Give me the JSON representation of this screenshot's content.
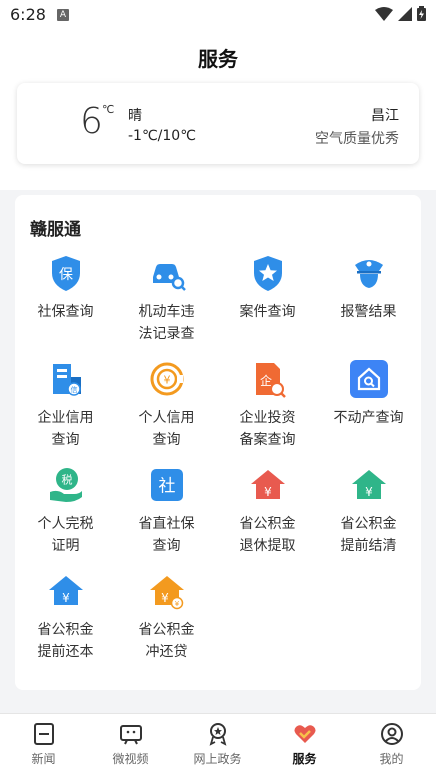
{
  "status": {
    "time": "6:28",
    "app_icon_letter": "A"
  },
  "header": {
    "title": "服务"
  },
  "weather": {
    "temp": "6",
    "unit": "℃",
    "condition": "晴",
    "range": "-1℃/10℃",
    "city": "昌江",
    "air_quality": "空气质量优秀"
  },
  "section": {
    "title": "赣服通",
    "items": [
      {
        "label": "社保查询",
        "icon": "shield-icon",
        "color": "#2f8ee8"
      },
      {
        "label": "机动车违\n法记录查",
        "icon": "car-search-icon",
        "color": "#2f8ee8"
      },
      {
        "label": "案件查询",
        "icon": "star-badge-icon",
        "color": "#2f8ee8"
      },
      {
        "label": "报警结果",
        "icon": "police-icon",
        "color": "#2f8ee8"
      },
      {
        "label": "企业信用\n查询",
        "icon": "enterprise-credit-icon",
        "color": "#2f8ee8"
      },
      {
        "label": "个人信用\n查询",
        "icon": "personal-credit-icon",
        "color": "#f39a1f"
      },
      {
        "label": "企业投资\n备案查询",
        "icon": "enterprise-invest-icon",
        "color": "#f06a33"
      },
      {
        "label": "不动产查询",
        "icon": "real-estate-icon",
        "color": "#3d84f5"
      },
      {
        "label": "个人完税\n证明",
        "icon": "tax-icon",
        "color": "#2fb589"
      },
      {
        "label": "省直社保\n查询",
        "icon": "social-security-icon",
        "color": "#2f8ee8"
      },
      {
        "label": "省公积金\n退休提取",
        "icon": "fund-house-red-icon",
        "color": "#e85a4f"
      },
      {
        "label": "省公积金\n提前结清",
        "icon": "fund-house-green-icon",
        "color": "#2fb589"
      },
      {
        "label": "省公积金\n提前还本",
        "icon": "fund-house-blue-icon",
        "color": "#2f8ee8"
      },
      {
        "label": "省公积金\n冲还贷",
        "icon": "fund-house-orange-icon",
        "color": "#f39a1f"
      }
    ]
  },
  "tabs": [
    {
      "label": "新闻",
      "icon": "news-icon",
      "active": false
    },
    {
      "label": "微视频",
      "icon": "video-icon",
      "active": false
    },
    {
      "label": "网上政务",
      "icon": "gov-icon",
      "active": false
    },
    {
      "label": "服务",
      "icon": "service-heart-icon",
      "active": true
    },
    {
      "label": "我的",
      "icon": "profile-icon",
      "active": false
    }
  ]
}
